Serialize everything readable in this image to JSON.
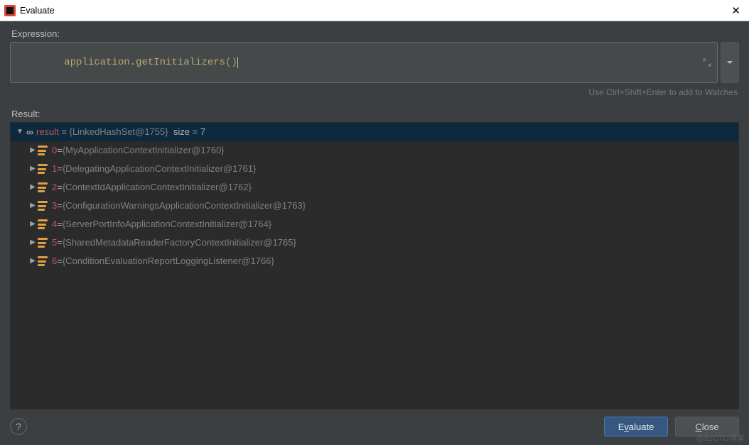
{
  "window": {
    "title": "Evaluate"
  },
  "labels": {
    "expression": "Expression:",
    "result": "Result:"
  },
  "expression": {
    "receiver": "application",
    "dot": ".",
    "method": "getInitializers",
    "paren_open": "(",
    "paren_close": ")"
  },
  "hint": "Use Ctrl+Shift+Enter to add to Watches",
  "result": {
    "root": {
      "name": "result",
      "value": "{LinkedHashSet@1755}",
      "extra": "size = 7"
    },
    "items": [
      {
        "index": "0",
        "value": "{MyApplicationContextInitializer@1760}"
      },
      {
        "index": "1",
        "value": "{DelegatingApplicationContextInitializer@1761}"
      },
      {
        "index": "2",
        "value": "{ContextIdApplicationContextInitializer@1762}"
      },
      {
        "index": "3",
        "value": "{ConfigurationWarningsApplicationContextInitializer@1763}"
      },
      {
        "index": "4",
        "value": "{ServerPortInfoApplicationContextInitializer@1764}"
      },
      {
        "index": "5",
        "value": "{SharedMetadataReaderFactoryContextInitializer@1765}"
      },
      {
        "index": "6",
        "value": "{ConditionEvaluationReportLoggingListener@1766}"
      }
    ]
  },
  "buttons": {
    "evaluate_pre": "E",
    "evaluate_mn": "v",
    "evaluate_post": "aluate",
    "close_pre": "",
    "close_mn": "C",
    "close_post": "lose"
  },
  "watermark": "@51CTO博客"
}
